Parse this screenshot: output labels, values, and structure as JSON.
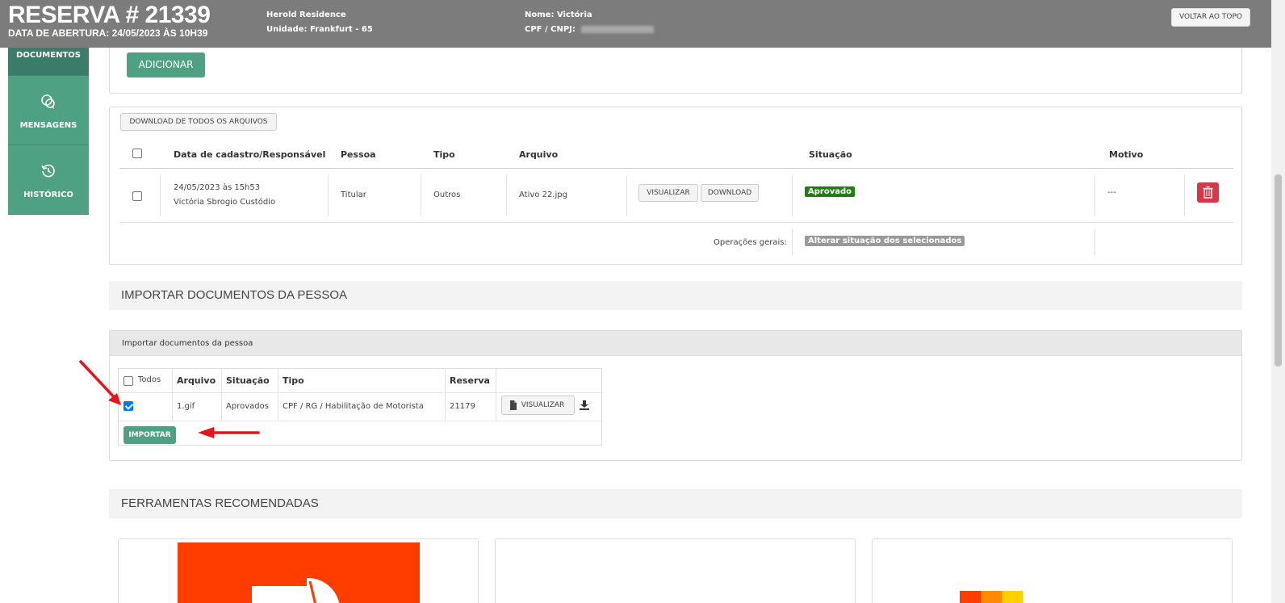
{
  "header": {
    "title": "RESERVA # 21339",
    "subtitle": "DATA DE ABERTURA: 24/05/2023 ÀS 10H39",
    "residence": "Herold Residence",
    "unit_label": "Unidade:",
    "unit_value": "Frankfurt - 65",
    "name_label": "Nome:",
    "name_value": "Victória",
    "cpf_label": "CPF / CNPJ:",
    "back_to_top": "VOLTAR AO TOPO"
  },
  "sidebar": {
    "items": [
      {
        "label": "DOCUMENTOS",
        "icon": "document-icon"
      },
      {
        "label": "MENSAGENS",
        "icon": "chat-icon"
      },
      {
        "label": "HISTÓRICO",
        "icon": "history-icon"
      }
    ]
  },
  "documents": {
    "add_button": "ADICIONAR",
    "download_all": "DOWNLOAD DE TODOS OS ARQUIVOS",
    "columns": [
      "Data de cadastro/Responsável",
      "Pessoa",
      "Tipo",
      "Arquivo",
      "Situação",
      "Motivo"
    ],
    "rows": [
      {
        "date": "24/05/2023 às 15h53",
        "responsible": "Victória Sbrogio Custódio",
        "person": "Titular",
        "type": "Outros",
        "file": "Ativo 22.jpg",
        "view_label": "VISUALIZAR",
        "download_label": "DOWNLOAD",
        "status": "Aprovado",
        "status_color": "#1e7e10",
        "reason": "---"
      }
    ],
    "general_ops_label": "Operações gerais:",
    "change_status_label": "Alterar situação dos selecionados"
  },
  "import_section": {
    "heading": "IMPORTAR DOCUMENTOS DA PESSOA",
    "panel_title": "Importar documentos da pessoa",
    "columns": [
      "Todos",
      "Arquivo",
      "Situação",
      "Tipo",
      "Reserva"
    ],
    "rows": [
      {
        "checked": true,
        "file": "1.gif",
        "status": "Aprovados",
        "type": "CPF / RG / Habilitação de Motorista",
        "reservation": "21179",
        "view_label": "VISUALIZAR"
      }
    ],
    "import_button": "IMPORTAR"
  },
  "tools_section": {
    "heading": "FERRAMENTAS RECOMENDADAS"
  },
  "colors": {
    "accent": "#4fa183",
    "header_bg": "#7c7c7c",
    "delete": "#dc3545",
    "annotation_arrow": "#e8141b"
  }
}
